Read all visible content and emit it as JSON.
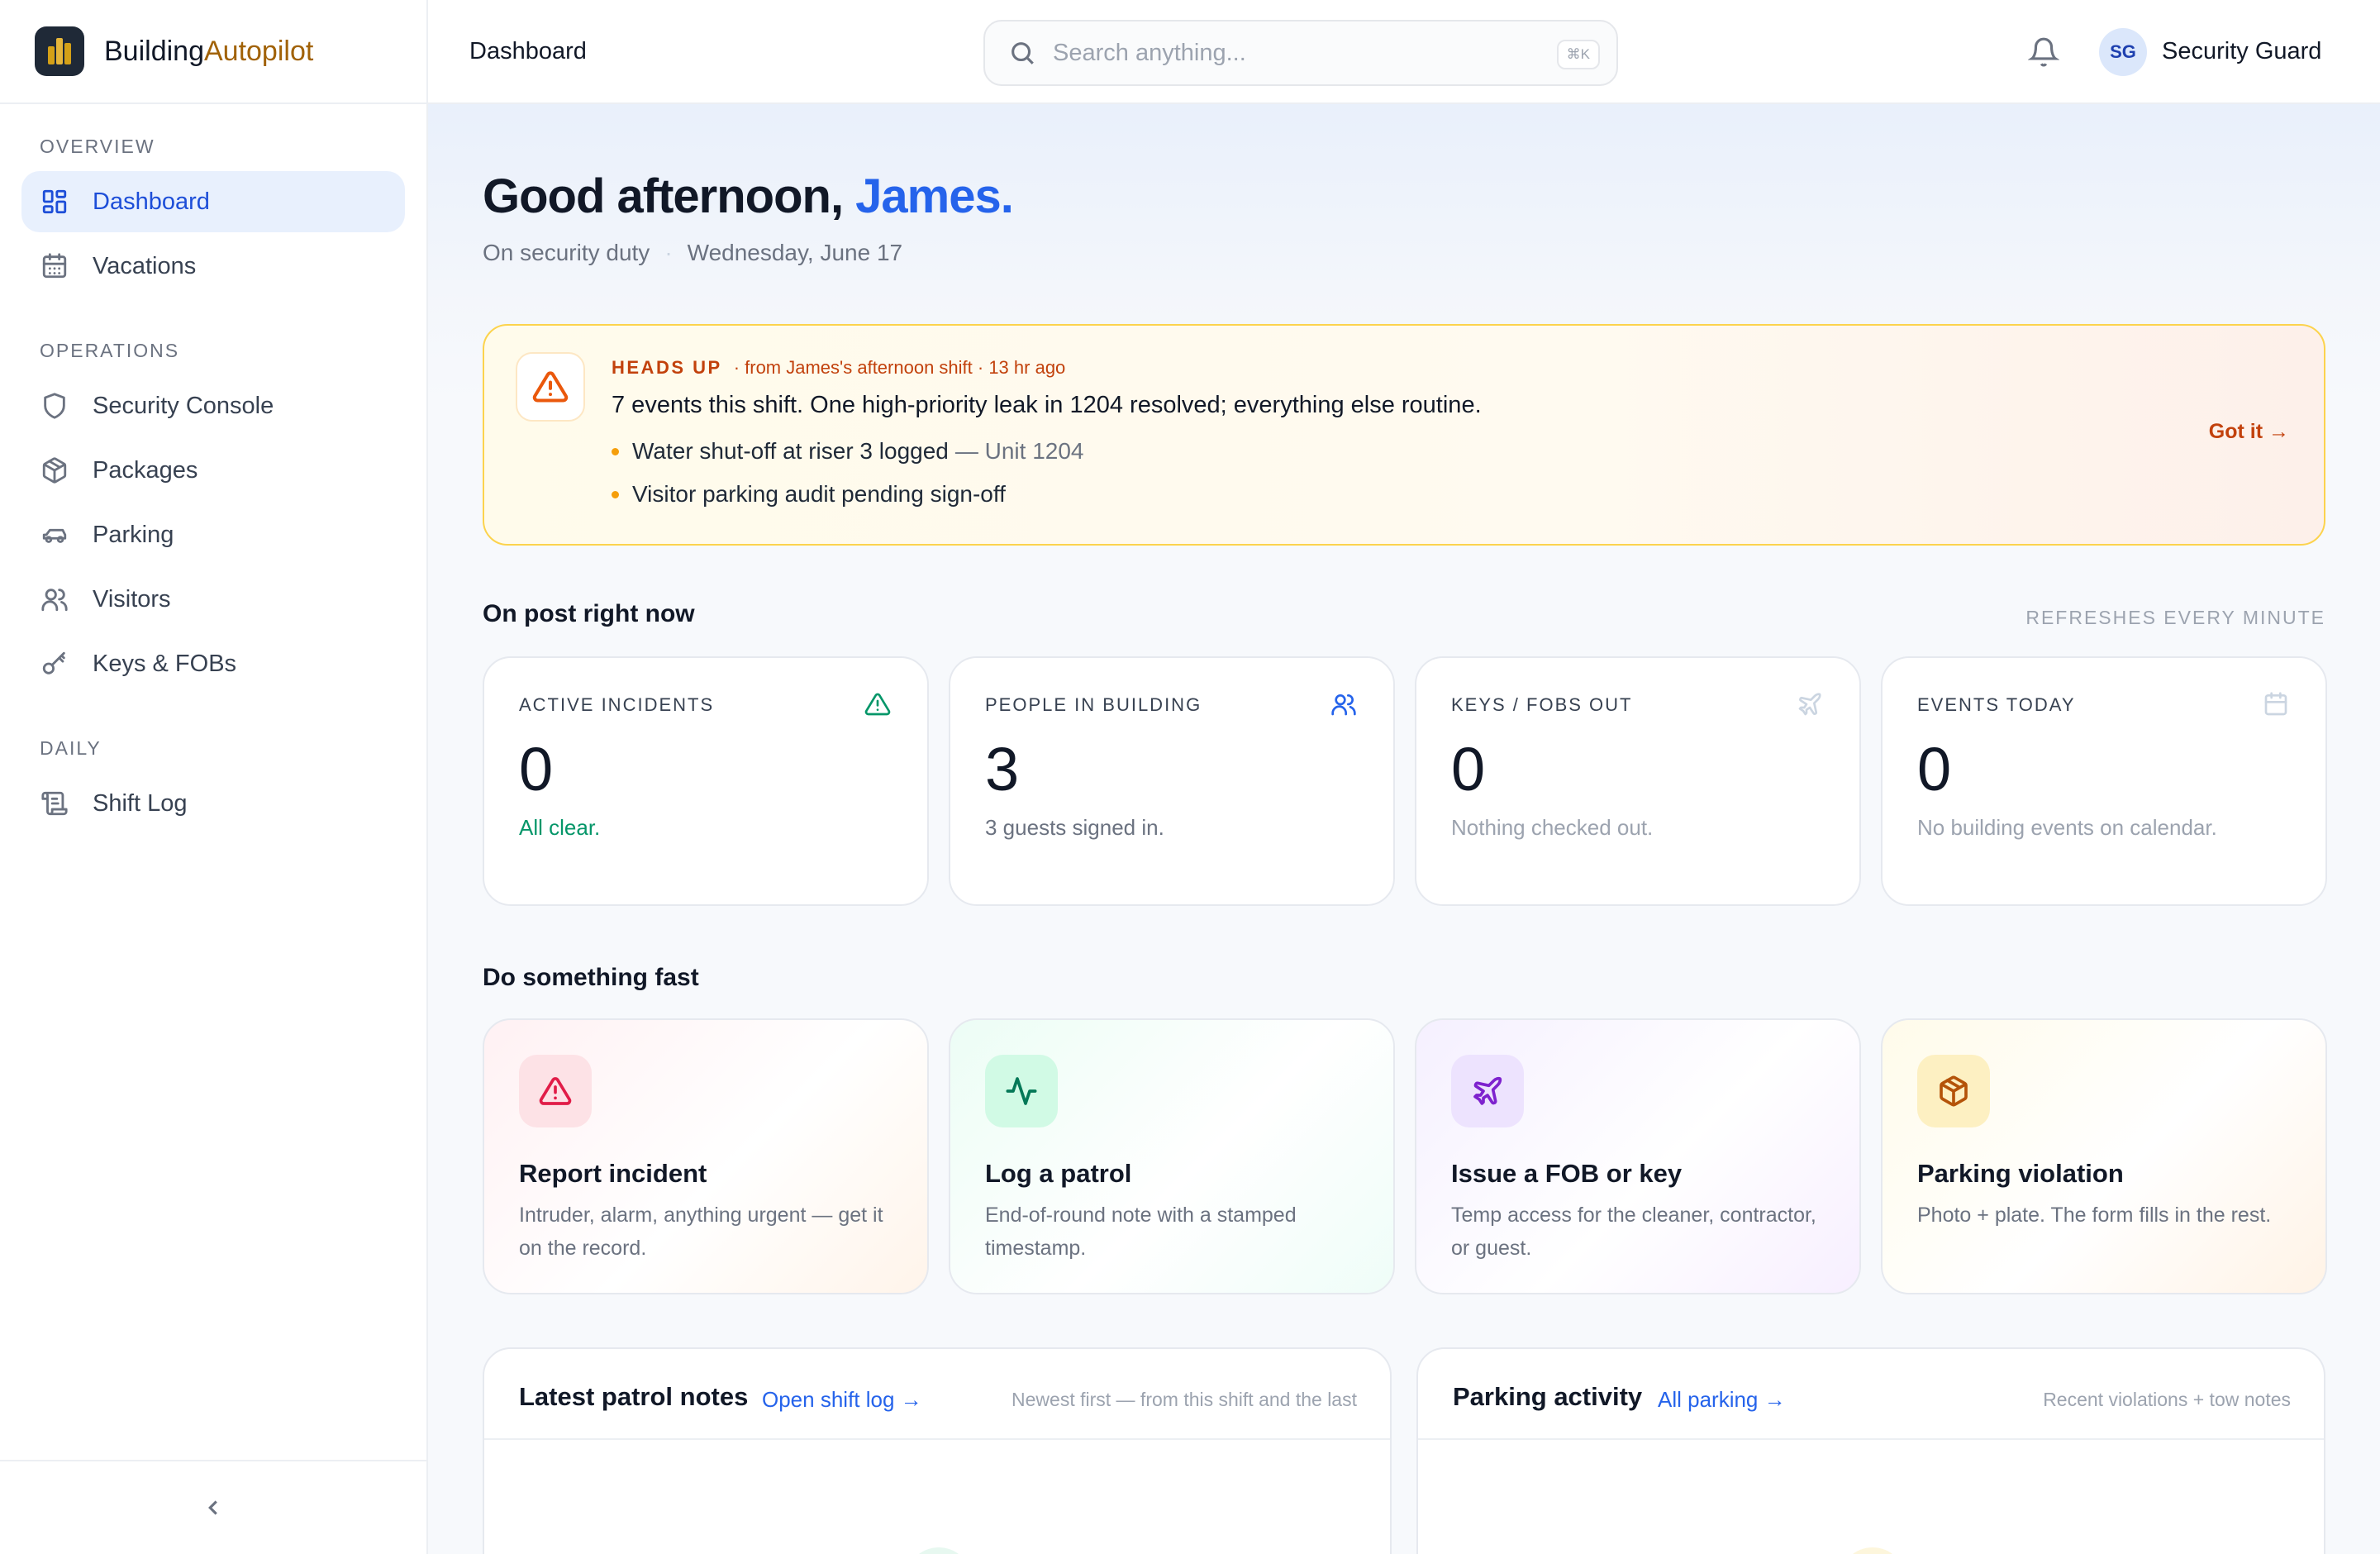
{
  "brand": {
    "name_a": "Building",
    "name_b": "Autopilot"
  },
  "sidebar": {
    "sections": [
      {
        "label": "OVERVIEW"
      },
      {
        "label": "OPERATIONS"
      },
      {
        "label": "DAILY"
      }
    ],
    "items": [
      {
        "label": "Dashboard",
        "icon": "grid-icon",
        "active": true
      },
      {
        "label": "Vacations",
        "icon": "calendar-icon"
      },
      {
        "label": "Security Console",
        "icon": "shield-icon"
      },
      {
        "label": "Packages",
        "icon": "package-icon"
      },
      {
        "label": "Parking",
        "icon": "car-icon"
      },
      {
        "label": "Visitors",
        "icon": "users-icon"
      },
      {
        "label": "Keys & FOBs",
        "icon": "key-icon"
      },
      {
        "label": "Shift Log",
        "icon": "scroll-icon"
      }
    ],
    "collapse_icon": "chevron-left-icon"
  },
  "header": {
    "breadcrumb": "Dashboard",
    "search_placeholder": "Search anything...",
    "search_shortcut": "⌘K",
    "avatar_initials": "SG",
    "user_role": "Security Guard"
  },
  "greeting": {
    "prefix": "Good afternoon, ",
    "name": "James.",
    "status": "On security duty",
    "date": "Wednesday, June 17"
  },
  "heads_up": {
    "tag": "HEADS UP",
    "source": "· from James's afternoon shift · 13 hr ago",
    "message": "7 events this shift. One high-priority leak in 1204 resolved; everything else routine.",
    "bullets": [
      {
        "text": "Water shut-off at riser 3 logged",
        "unit": "— Unit 1204"
      },
      {
        "text": "Visitor parking audit pending sign-off",
        "unit": ""
      }
    ],
    "action": "Got it →"
  },
  "on_post": {
    "title": "On post right now",
    "refresh_note": "REFRESHES EVERY MINUTE",
    "cards": [
      {
        "caption": "ACTIVE INCIDENTS",
        "value": "0",
        "note": "All clear.",
        "icon": "alert-triangle-icon",
        "color": "#059669"
      },
      {
        "caption": "PEOPLE IN BUILDING",
        "value": "3",
        "note": "3 guests signed in.",
        "icon": "users-icon",
        "color": "#2563eb"
      },
      {
        "caption": "KEYS / FOBS OUT",
        "value": "0",
        "note": "Nothing checked out.",
        "icon": "plane-icon",
        "color": "#cbd5e1"
      },
      {
        "caption": "EVENTS TODAY",
        "value": "0",
        "note": "No building events on calendar.",
        "icon": "calendar-icon",
        "color": "#cbd5e1"
      }
    ]
  },
  "quick_actions": {
    "title": "Do something fast",
    "items": [
      {
        "title": "Report incident",
        "desc": "Intruder, alarm, anything urgent — get it on the record.",
        "icon": "alert-triangle-icon",
        "color": "#e11d48"
      },
      {
        "title": "Log a patrol",
        "desc": "End-of-round note with a stamped timestamp.",
        "icon": "activity-icon",
        "color": "#059669"
      },
      {
        "title": "Issue a FOB or key",
        "desc": "Temp access for the cleaner, contractor, or guest.",
        "icon": "plane-icon",
        "color": "#7e22ce"
      },
      {
        "title": "Parking violation",
        "desc": "Photo + plate. The form fills in the rest.",
        "icon": "package-icon",
        "color": "#b45309"
      }
    ]
  },
  "panels": [
    {
      "title": "Latest patrol notes",
      "link": "Open shift log →",
      "note": "Newest first — from this shift and the last"
    },
    {
      "title": "Parking activity",
      "link": "All parking →",
      "note": "Recent violations + tow notes"
    }
  ]
}
